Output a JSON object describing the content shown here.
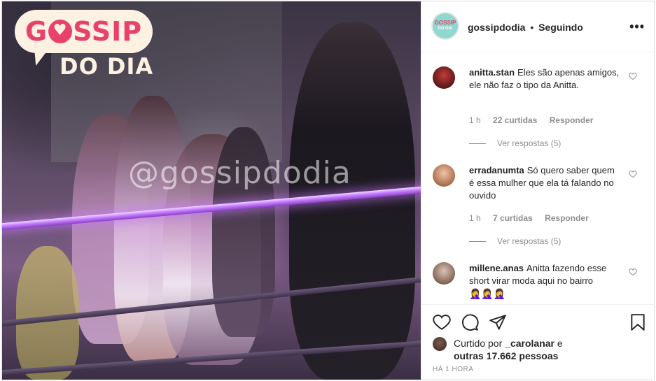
{
  "post": {
    "logo": {
      "line1": "GOSSIP",
      "line2": "DO DIA"
    },
    "watermark": "@gossipdodia"
  },
  "header": {
    "username": "gossipdodia",
    "separator": "•",
    "follow_status": "Seguindo",
    "more_label": "•••",
    "avatar_text_1": "GOSSIP",
    "avatar_text_2": "DO DIA"
  },
  "comments": [
    {
      "user": "anitta.stan",
      "text": "Eles são apenas amigos, ele não faz o tipo da Anitta.",
      "time": "1 h",
      "likes": "22 curtidas",
      "reply": "Responder",
      "view_replies": "Ver respostas (5)"
    },
    {
      "user": "erradanumta",
      "text": "Só quero saber quem é essa mulher que ela tá falando no ouvido",
      "time": "1 h",
      "likes": "7 curtidas",
      "reply": "Responder",
      "view_replies": "Ver respostas (5)"
    },
    {
      "user": "millene.anas",
      "text": "Anitta fazendo esse short virar moda aqui no bairro",
      "emoji": "🤦‍♀️🤦‍♀️🤦‍♀️"
    }
  ],
  "liked_by": {
    "prefix": "Curtido por",
    "user": "_carolanar",
    "conj": "e",
    "others": "outras 17.662 pessoas"
  },
  "timestamp": "HÁ 1 HORA",
  "colors": {
    "brand_pink": "#e8416b",
    "logo_cream": "#fdf1e2",
    "muted": "#8e8e8e",
    "text": "#262626"
  },
  "icons": [
    "heart-icon",
    "comment-icon",
    "share-icon",
    "bookmark-icon",
    "more-icon"
  ]
}
